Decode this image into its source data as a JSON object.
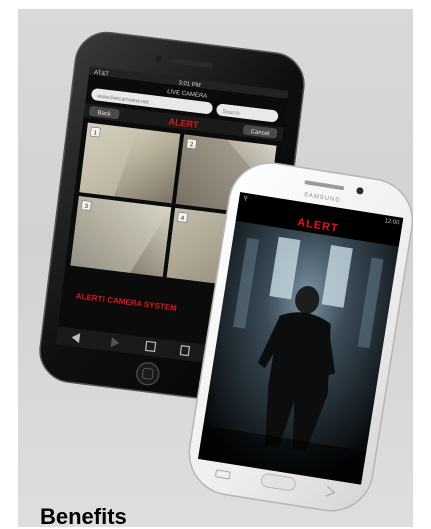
{
  "heading": "Benefits",
  "iphone": {
    "status_time": "3:01 PM",
    "tab_title": "LIVE CAMERA",
    "url_text": "www.livecamview.net",
    "search_placeholder": "Search",
    "left_nav": "Back",
    "alert_label": "ALERT",
    "right_nav": "Cancel",
    "camera_tiles": [
      "1",
      "2",
      "3",
      "4"
    ],
    "bottom_caption": "ALERT! CAMERA SYSTEM"
  },
  "android": {
    "brand": "SAMSUNG",
    "status_time": "12:00",
    "alert_label": "ALERT"
  },
  "colors": {
    "alert_red": "#e0141c",
    "background_gray": "#d7d7d7",
    "iphone_body": "#111111",
    "android_body": "#f4f4f4"
  }
}
